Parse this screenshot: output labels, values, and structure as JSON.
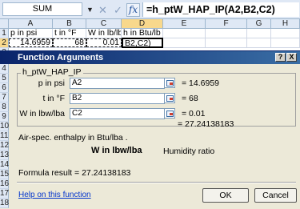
{
  "formula_bar": {
    "name_box": "SUM",
    "cancel_symbol": "✕",
    "enter_symbol": "✓",
    "fx_symbol": "fx",
    "formula": "=h_ptW_HAP_IP(A2,B2,C2)"
  },
  "grid": {
    "columns": [
      "A",
      "B",
      "C",
      "D",
      "E",
      "F",
      "G",
      "H"
    ],
    "row_numbers": [
      "1",
      "2",
      "3",
      "4",
      "5",
      "6",
      "7",
      "8",
      "9",
      "10",
      "11",
      "12",
      "13",
      "14",
      "15",
      "16",
      "17",
      "18",
      "19"
    ],
    "row1": {
      "a": "p in psi",
      "b": "t in °F",
      "c": "W in lb/lb",
      "d": "h in Btu/lb"
    },
    "row2": {
      "a": "14.6959",
      "b": "68",
      "c": "0.01",
      "d": "B2,C2)"
    }
  },
  "dialog": {
    "title": "Function Arguments",
    "help_button": "?",
    "close_button": "X",
    "function_name": "h_ptW_HAP_IP",
    "arguments": [
      {
        "label": "p in psi",
        "input": "A2",
        "value": "= 14.6959"
      },
      {
        "label": "t in °F",
        "input": "B2",
        "value": "= 68"
      },
      {
        "label": "W in lbw/lba",
        "input": "C2",
        "value": "= 0.01"
      }
    ],
    "result_preview": "= 27.24138183",
    "description": "Air-spec. enthalpy in Btu/lba .",
    "arg_help_name": "W in lbw/lba",
    "arg_help_text": "Humidity ratio",
    "formula_result": "Formula result =  27.24138183",
    "help_link": "Help on this function",
    "ok": "OK",
    "cancel": "Cancel"
  }
}
